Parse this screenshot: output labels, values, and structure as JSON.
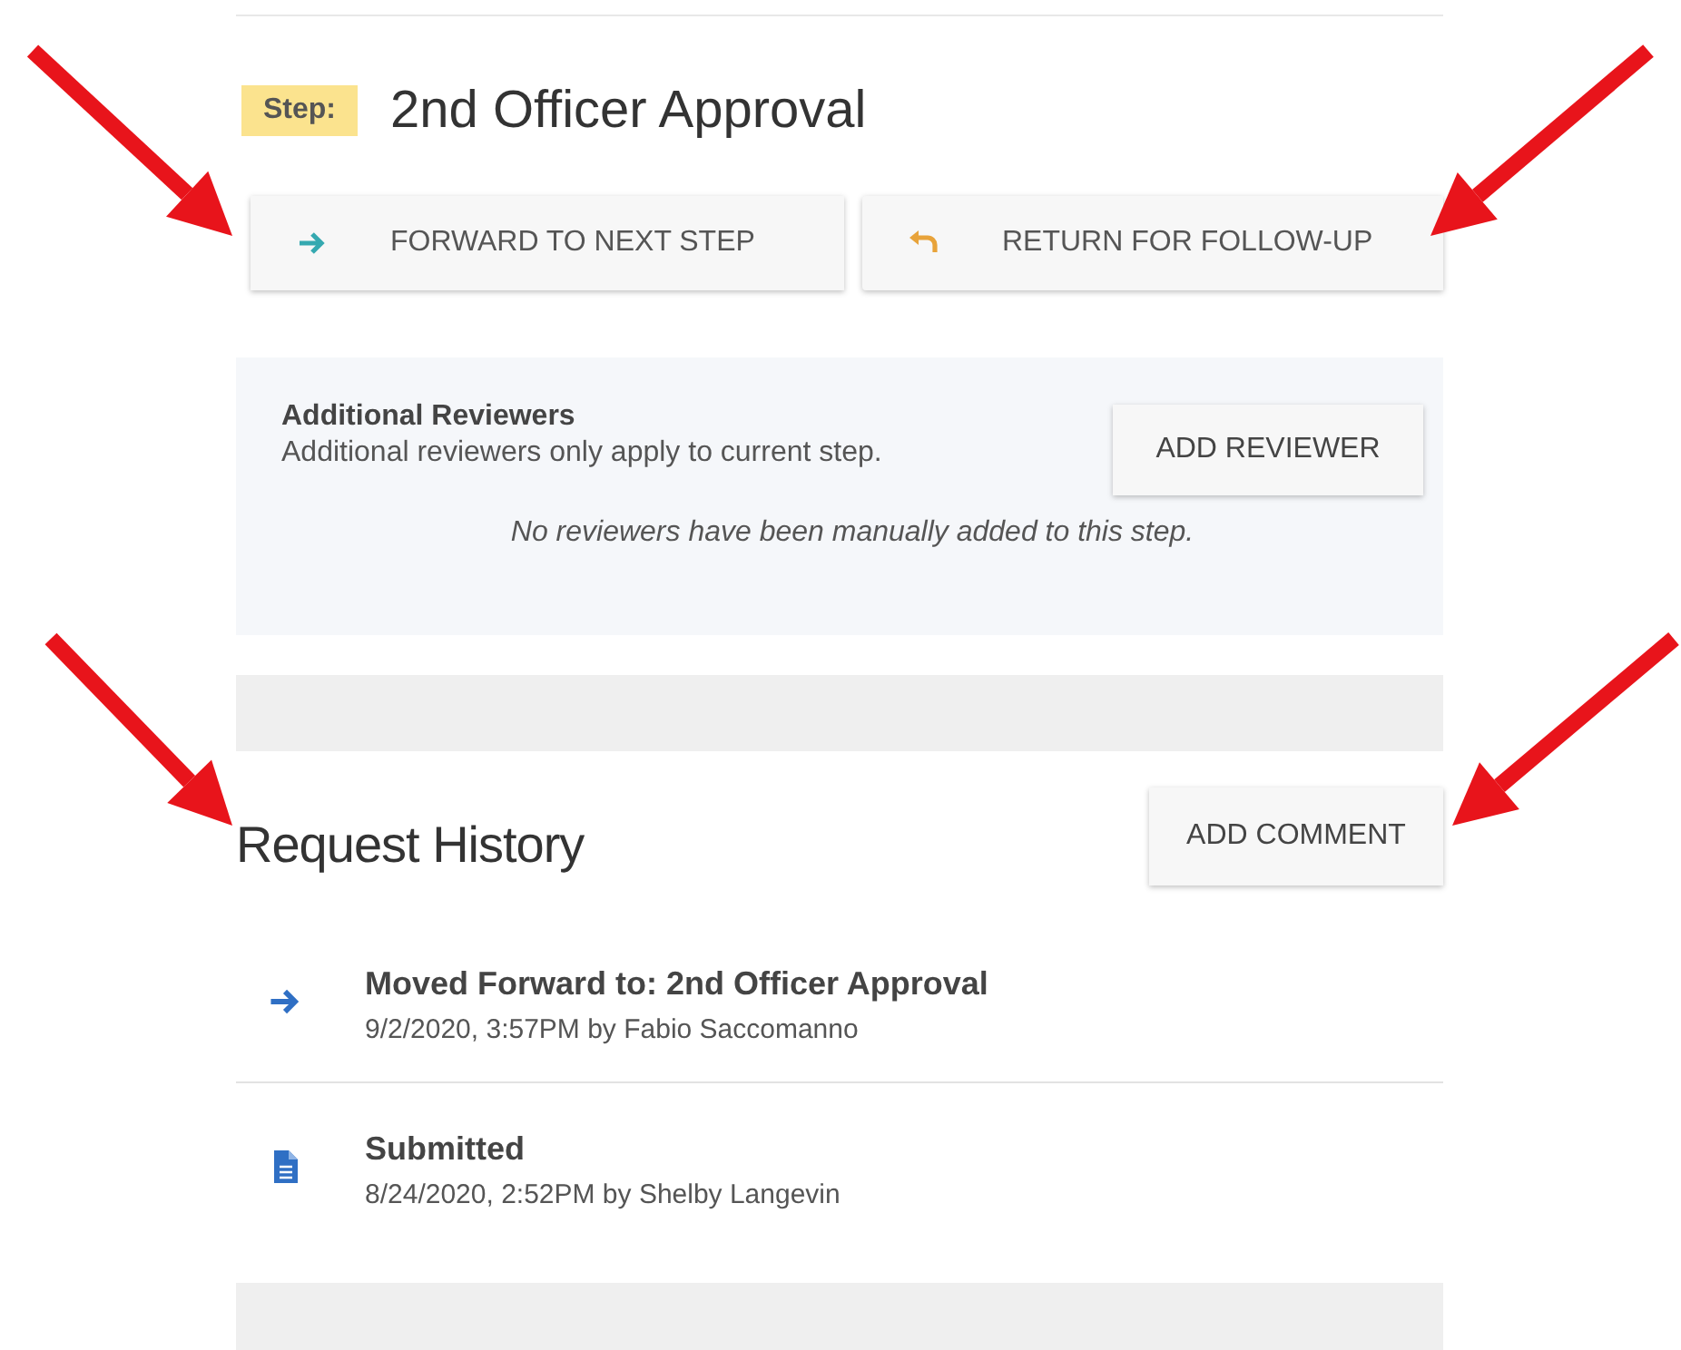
{
  "step": {
    "badge": "Step:",
    "title": "2nd Officer Approval"
  },
  "actions": [
    {
      "kind": "forward",
      "label": "FORWARD TO NEXT STEP"
    },
    {
      "kind": "return",
      "label": "RETURN FOR FOLLOW-UP"
    }
  ],
  "reviewers": {
    "title": "Additional Reviewers",
    "description": "Additional reviewers only apply to current step.",
    "button": "ADD REVIEWER",
    "empty": "No reviewers have been manually added to this step."
  },
  "history": {
    "title": "Request History",
    "button": "ADD COMMENT",
    "entries": [
      {
        "kind": "forward",
        "title": "Moved Forward to: 2nd Officer Approval",
        "meta": "9/2/2020, 3:57PM by Fabio Saccomanno"
      },
      {
        "kind": "document",
        "title": "Submitted",
        "meta": "8/24/2020, 2:52PM by Shelby Langevin"
      }
    ]
  }
}
